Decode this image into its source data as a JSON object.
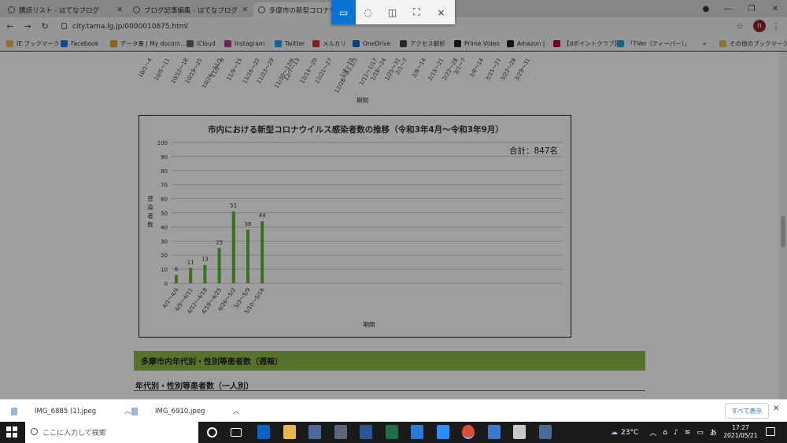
{
  "browser": {
    "tabs": [
      {
        "title": "購読リスト - はてなブログ",
        "active": false
      },
      {
        "title": "ブログ記事編集 - はてなブログ",
        "active": false
      },
      {
        "title": "多摩市の新型コロナウイルス",
        "active": true
      }
    ],
    "url": "city.tama.lg.jp/0000010875.html",
    "profile_initial": "n",
    "bookmarks": [
      {
        "label": "IE ブックマーク",
        "icon": "folder-icon",
        "color": "#e8b84a"
      },
      {
        "label": "Facebook",
        "icon": "facebook-icon",
        "color": "#1877f2"
      },
      {
        "label": "データ量 | My docom...",
        "icon": "docomo-icon",
        "color": "#e0a020"
      },
      {
        "label": "iCloud",
        "icon": "apple-icon",
        "color": "#666666"
      },
      {
        "label": "Instagram",
        "icon": "instagram-icon",
        "color": "#c13584"
      },
      {
        "label": "Twitter",
        "icon": "twitter-icon",
        "color": "#1da1f2"
      },
      {
        "label": "メルカリ",
        "icon": "mercari-icon",
        "color": "#e03030"
      },
      {
        "label": "OneDrive",
        "icon": "onedrive-icon",
        "color": "#0a6cd6"
      },
      {
        "label": "アクセス解析",
        "icon": "hatena-icon",
        "color": "#444444"
      },
      {
        "label": "Prime Video",
        "icon": "amazon-icon",
        "color": "#222222"
      },
      {
        "label": "Amazon |",
        "icon": "amazon-icon",
        "color": "#222222"
      },
      {
        "label": "【dポイントクラブ】",
        "icon": "dpoint-icon",
        "color": "#cc0033"
      },
      {
        "label": "「TVer（ティーバー）」",
        "icon": "tver-icon",
        "color": "#22a0c8"
      }
    ],
    "bookmarks_overflow": "»",
    "other_bookmarks": "その他のブックマーク"
  },
  "snip_toolbar": {
    "modes": [
      "rectangle-snip",
      "freeform-snip",
      "window-snip",
      "fullscreen-snip"
    ],
    "selected": "rectangle-snip",
    "close": "×"
  },
  "page": {
    "previous_chart_ticks": [
      "10/1〜4",
      "10/5〜11",
      "10/12〜18",
      "10/19〜25",
      "10/26〜11/1",
      "11/2〜8",
      "11/9〜15",
      "11/16〜22",
      "11/23〜29",
      "11/30〜12/6",
      "12/7〜13",
      "12/14〜20",
      "12/21〜27",
      "12/28〜R3.1/3",
      "1/4〜10",
      "1/11〜1/17",
      "1/18〜24",
      "1/25〜31",
      "2/1〜7",
      "2/8〜14",
      "2/15〜21",
      "2/22〜28",
      "3/1〜7",
      "3/8〜14",
      "3/15〜21",
      "3/22〜28",
      "3/29〜31"
    ],
    "previous_chart_xlabel": "期間",
    "section_header": "多摩市内年代別・性別等患者数（週報）",
    "subheading": "年代別・性別等患者数（一人別）"
  },
  "chart_data": {
    "type": "bar",
    "title": "市内における新型コロナウイルス感染者数の推移（令和3年4月〜令和3年9月）",
    "total_label": "合計：847名",
    "xlabel": "期間",
    "ylabel": "感染者数",
    "ylim": [
      0,
      100
    ],
    "yticks": [
      0,
      10,
      20,
      30,
      40,
      50,
      60,
      70,
      80,
      90,
      100
    ],
    "grid": true,
    "categories": [
      "4/1〜4/4",
      "4/5〜4/11",
      "4/12〜4/18",
      "4/19〜4/25",
      "4/26〜5/2",
      "5/3〜5/9",
      "5/10〜5/16"
    ],
    "values": [
      6,
      11,
      13,
      25,
      51,
      38,
      44
    ],
    "bar_color": "#5cb82a"
  },
  "downloads": {
    "items": [
      "IMG_6885 (1).jpeg",
      "IMG_6910.jpeg"
    ],
    "show_all": "すべて表示"
  },
  "taskbar": {
    "search_placeholder": "ここに入力して検索",
    "apps": [
      {
        "icon": "outlook-icon",
        "color": "#0a64c8"
      },
      {
        "icon": "file-explorer-icon",
        "color": "#e8b84a"
      },
      {
        "icon": "app-icon",
        "color": "#4a6a9a"
      },
      {
        "icon": "calculator-icon",
        "color": "#5a6a7a"
      },
      {
        "icon": "word-icon",
        "color": "#2b5797"
      },
      {
        "icon": "excel-icon",
        "color": "#1e7145"
      },
      {
        "icon": "mail-icon",
        "color": "#2a7ad8"
      },
      {
        "icon": "zoom-icon",
        "color": "#2d8cff"
      },
      {
        "icon": "chrome-icon",
        "color": "#e04a3a"
      },
      {
        "icon": "photos-icon",
        "color": "#3a7ac8"
      },
      {
        "icon": "paint-icon",
        "color": "#c8c8c8"
      },
      {
        "icon": "app-icon",
        "color": "#4a6a9a"
      }
    ],
    "temperature": "23°C",
    "ime": "あ",
    "time": "17:27",
    "date": "2021/05/21"
  }
}
